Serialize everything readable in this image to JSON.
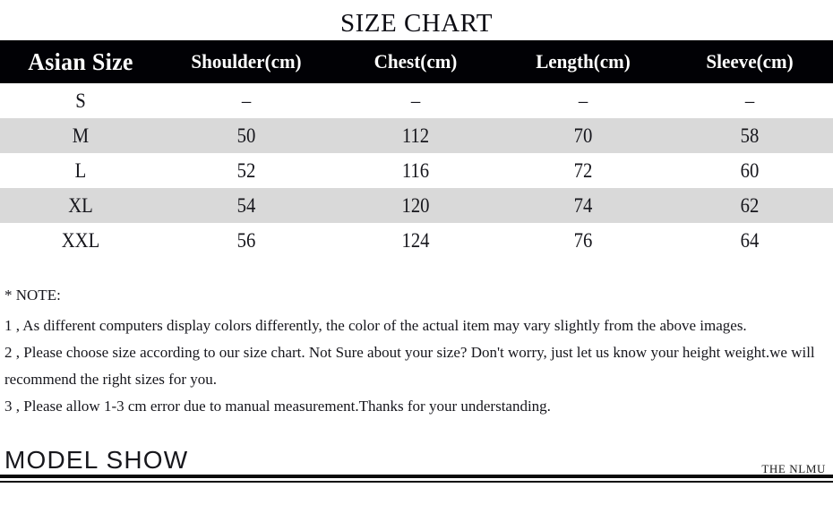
{
  "title": "SIZE CHART",
  "table": {
    "columns": [
      {
        "key": "size",
        "label": "Asian Size"
      },
      {
        "key": "shoulder",
        "label": "Shoulder(cm)"
      },
      {
        "key": "chest",
        "label": "Chest(cm)"
      },
      {
        "key": "length",
        "label": "Length(cm)"
      },
      {
        "key": "sleeve",
        "label": "Sleeve(cm)"
      }
    ],
    "rows": [
      {
        "size": "S",
        "shoulder": "–",
        "chest": "–",
        "length": "–",
        "sleeve": "–"
      },
      {
        "size": "M",
        "shoulder": "50",
        "chest": "112",
        "length": "70",
        "sleeve": "58"
      },
      {
        "size": "L",
        "shoulder": "52",
        "chest": "116",
        "length": "72",
        "sleeve": "60"
      },
      {
        "size": "XL",
        "shoulder": "54",
        "chest": "120",
        "length": "74",
        "sleeve": "62"
      },
      {
        "size": "XXL",
        "shoulder": "56",
        "chest": "124",
        "length": "76",
        "sleeve": "64"
      }
    ]
  },
  "notes": {
    "heading": "* NOTE:",
    "lines": [
      "1 , As different computers display colors differently, the color of the actual item may vary slightly from the above images.",
      "2 , Please choose size according to our size chart. Not Sure about your size? Don't worry, just let us know your height weight.we will",
      "recommend the right sizes for you.",
      "3 , Please allow 1-3 cm error due to manual measurement.Thanks for your understanding."
    ]
  },
  "footer": {
    "section_label": "MODEL SHOW",
    "brand": "THE NLMU"
  },
  "colors": {
    "header_background": "#010105",
    "header_text": "#ffffff",
    "row_shaded": "#d9d9d9",
    "row_plain": "#ffffff",
    "text": "#16161c",
    "rule": "#0a0a0a"
  },
  "chart_data": {
    "type": "table",
    "title": "SIZE CHART",
    "columns": [
      "Asian Size",
      "Shoulder(cm)",
      "Chest(cm)",
      "Length(cm)",
      "Sleeve(cm)"
    ],
    "rows": [
      [
        "S",
        "–",
        "–",
        "–",
        "–"
      ],
      [
        "M",
        "50",
        "112",
        "70",
        "58"
      ],
      [
        "L",
        "52",
        "116",
        "72",
        "60"
      ],
      [
        "XL",
        "54",
        "120",
        "74",
        "62"
      ],
      [
        "XXL",
        "56",
        "124",
        "76",
        "64"
      ]
    ],
    "units": "cm",
    "notes": [
      "1 , As different computers display colors differently, the color of the actual item may vary slightly from the above images.",
      "2 , Please choose size according to our size chart. Not Sure about your size? Don't worry, just let us know your height weight.we will recommend the right sizes for you.",
      "3 , Please allow 1-3 cm error due to manual measurement.Thanks for your understanding."
    ]
  }
}
